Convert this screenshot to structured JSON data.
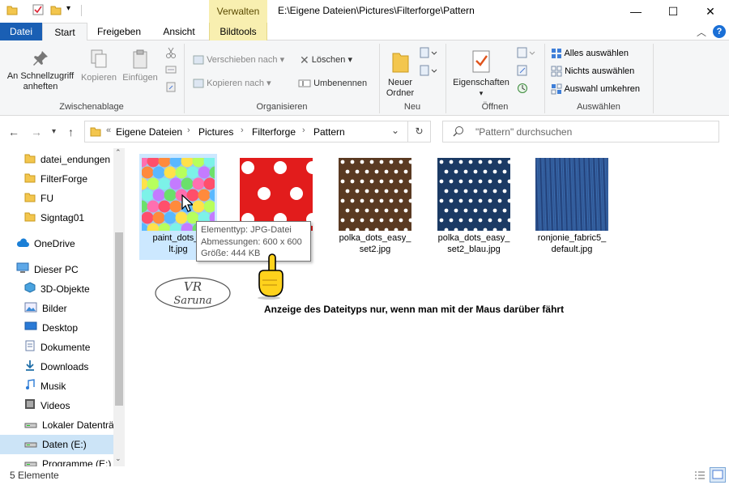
{
  "title_bar": {
    "context_tab": "Verwalten",
    "path": "E:\\Eigene Dateien\\Pictures\\Filterforge\\Pattern",
    "minimize_glyph": "—",
    "maximize_glyph": "☐",
    "close_glyph": "✕"
  },
  "tabs": {
    "datei": "Datei",
    "start": "Start",
    "freigeben": "Freigeben",
    "ansicht": "Ansicht",
    "bildtools": "Bildtools"
  },
  "ribbon": {
    "pin": "An Schnellzugriff anheften",
    "kopieren": "Kopieren",
    "einfuegen": "Einfügen",
    "group_clipboard": "Zwischenablage",
    "verschieben": "Verschieben nach",
    "kopieren_nach": "Kopieren nach",
    "loeschen": "Löschen",
    "umbenennen": "Umbenennen",
    "group_organize": "Organisieren",
    "neuer_ordner": "Neuer Ordner",
    "group_new": "Neu",
    "eigenschaften": "Eigenschaften",
    "group_open": "Öffnen",
    "alles": "Alles auswählen",
    "nichts": "Nichts auswählen",
    "umkehren": "Auswahl umkehren",
    "group_select": "Auswählen"
  },
  "address": {
    "overflow": "«",
    "crumbs": [
      "Eigene Dateien",
      "Pictures",
      "Filterforge",
      "Pattern"
    ],
    "search_placeholder": "\"Pattern\" durchsuchen"
  },
  "nav": {
    "items": [
      {
        "label": "datei_endungen",
        "icon": "folder-icon"
      },
      {
        "label": "FilterForge",
        "icon": "folder-icon"
      },
      {
        "label": "FU",
        "icon": "folder-icon"
      },
      {
        "label": "Signtag01",
        "icon": "folder-icon"
      },
      {
        "label": "OneDrive",
        "icon": "cloud-icon"
      },
      {
        "label": "Dieser PC",
        "icon": "pc-icon"
      },
      {
        "label": "3D-Objekte",
        "icon": "cube-icon"
      },
      {
        "label": "Bilder",
        "icon": "pictures-icon"
      },
      {
        "label": "Desktop",
        "icon": "desktop-icon"
      },
      {
        "label": "Dokumente",
        "icon": "documents-icon"
      },
      {
        "label": "Downloads",
        "icon": "download-icon"
      },
      {
        "label": "Musik",
        "icon": "music-icon"
      },
      {
        "label": "Videos",
        "icon": "video-icon"
      },
      {
        "label": "Lokaler Datenträ",
        "icon": "drive-icon"
      },
      {
        "label": "Daten (E:)",
        "icon": "drive-icon"
      },
      {
        "label": "Programme (E:)",
        "icon": "drive-icon"
      }
    ]
  },
  "files": [
    {
      "line1": "paint_dots_e",
      "line2": "lt.jpg",
      "thumb": "colorful-dots"
    },
    {
      "line1": "",
      "line2": "",
      "thumb": "red-dots"
    },
    {
      "line1": "polka_dots_easy_",
      "line2": "set2.jpg",
      "thumb": "brown-dots"
    },
    {
      "line1": "polka_dots_easy_",
      "line2": "set2_blau.jpg",
      "thumb": "navy-dots"
    },
    {
      "line1": "ronjonie_fabric5_",
      "line2": "default.jpg",
      "thumb": "blue-fabric"
    }
  ],
  "partial_filename_tail": "_",
  "tooltip": {
    "type": "Elementtyp: JPG-Datei",
    "dims": "Abmessungen: 600 x 600",
    "size": "Größe: 444 KB"
  },
  "annotation": "Anzeige des Dateityps nur, wenn man mit der Maus darüber fährt",
  "status": "5 Elemente",
  "colors": {
    "accent": "#1a5fb4",
    "context": "#f8efb0",
    "selection": "#cce8ff"
  }
}
